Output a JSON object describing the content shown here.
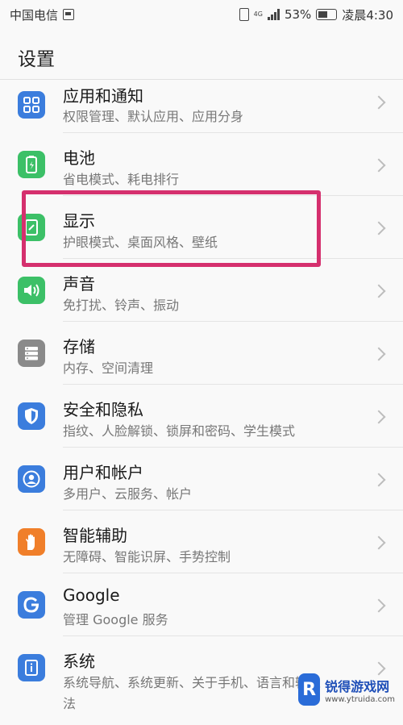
{
  "status_bar": {
    "carrier": "中国电信",
    "network_type": "4G",
    "battery_percent": "53%",
    "time": "凌晨4:30"
  },
  "header": {
    "title": "设置"
  },
  "items": [
    {
      "title": "应用和通知",
      "subtitle": "权限管理、默认应用、应用分身",
      "icon": "apps-icon",
      "color": "#3b7ddd"
    },
    {
      "title": "电池",
      "subtitle": "省电模式、耗电排行",
      "icon": "battery-icon",
      "color": "#3cc067"
    },
    {
      "title": "显示",
      "subtitle": "护眼模式、桌面风格、壁纸",
      "icon": "display-icon",
      "color": "#3cc067"
    },
    {
      "title": "声音",
      "subtitle": "免打扰、铃声、振动",
      "icon": "sound-icon",
      "color": "#3cc067"
    },
    {
      "title": "存储",
      "subtitle": "内存、空间清理",
      "icon": "storage-icon",
      "color": "#8a8a8a"
    },
    {
      "title": "安全和隐私",
      "subtitle": "指纹、人脸解锁、锁屏和密码、学生模式",
      "icon": "shield-icon",
      "color": "#3b7ddd"
    },
    {
      "title": "用户和帐户",
      "subtitle": "多用户、云服务、帐户",
      "icon": "user-icon",
      "color": "#3b7ddd"
    },
    {
      "title": "智能辅助",
      "subtitle": "无障碍、智能识屏、手势控制",
      "icon": "hand-icon",
      "color": "#f07f2a"
    },
    {
      "title": "Google",
      "subtitle": "管理 Google 服务",
      "icon": "google-icon",
      "color": "#3b7ddd"
    },
    {
      "title": "系统",
      "subtitle": "系统导航、系统更新、关于手机、语言和输入",
      "subtitle_line2": "法",
      "icon": "system-icon",
      "color": "#3b7ddd"
    }
  ],
  "watermark": {
    "main": "锐得游戏网",
    "url": "www.ytruida.com",
    "logo_char": "R"
  }
}
